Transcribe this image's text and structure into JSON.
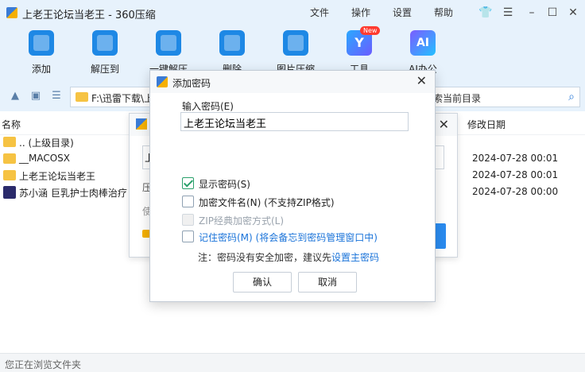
{
  "window": {
    "title": "上老王论坛当老王 - 360压缩",
    "menus": [
      "文件",
      "操作",
      "设置",
      "帮助"
    ]
  },
  "toolbar": {
    "items": [
      {
        "label": "添加",
        "icon": "add-archive-icon"
      },
      {
        "label": "解压到",
        "icon": "extract-to-icon"
      },
      {
        "label": "一键解压",
        "icon": "one-click-extract-icon"
      },
      {
        "label": "删除",
        "icon": "delete-icon"
      },
      {
        "label": "图片压缩",
        "icon": "image-compress-icon"
      },
      {
        "label": "工具",
        "icon": "tools-icon",
        "badge": "New",
        "glyph": "Y"
      },
      {
        "label": "AI办公",
        "icon": "ai-office-icon",
        "glyph": "AI"
      }
    ]
  },
  "address": {
    "path": "F:\\迅雷下载\\上",
    "search_placeholder": "索当前目录"
  },
  "file_list": {
    "columns": {
      "name": "名称",
      "modified": "修改日期"
    },
    "rows": [
      {
        "name": ".. (上级目录)",
        "date": "",
        "type": "folder"
      },
      {
        "name": "__MACOSX",
        "date": "2024-07-28 00:01",
        "type": "folder"
      },
      {
        "name": "上老王论坛当老王",
        "date": "2024-07-28 00:01",
        "type": "folder"
      },
      {
        "name": "苏小涵 巨乳护士肉棒治疗",
        "date": "2024-07-28 00:00",
        "type": "video"
      }
    ]
  },
  "status": {
    "text": "您正在浏览文件夹"
  },
  "bg_dialog": {
    "fragments": [
      "上",
      "压",
      "使"
    ]
  },
  "password_dialog": {
    "title": "添加密码",
    "input_label": "输入密码(E)",
    "password_value": "上老王论坛当老王",
    "options": [
      {
        "label": "显示密码(S)",
        "checked": true,
        "disabled": false,
        "link": false
      },
      {
        "label": "加密文件名(N) (不支持ZIP格式)",
        "checked": false,
        "disabled": false,
        "link": false
      },
      {
        "label": "ZIP经典加密方式(L)",
        "checked": false,
        "disabled": true,
        "link": false
      },
      {
        "label": "记住密码(M) (将会备忘到密码管理窗口中)",
        "checked": false,
        "disabled": false,
        "link": true
      }
    ],
    "note_prefix": "注：密码没有安全加密，建议先",
    "note_link": "设置主密码",
    "ok_label": "确认",
    "cancel_label": "取消"
  }
}
